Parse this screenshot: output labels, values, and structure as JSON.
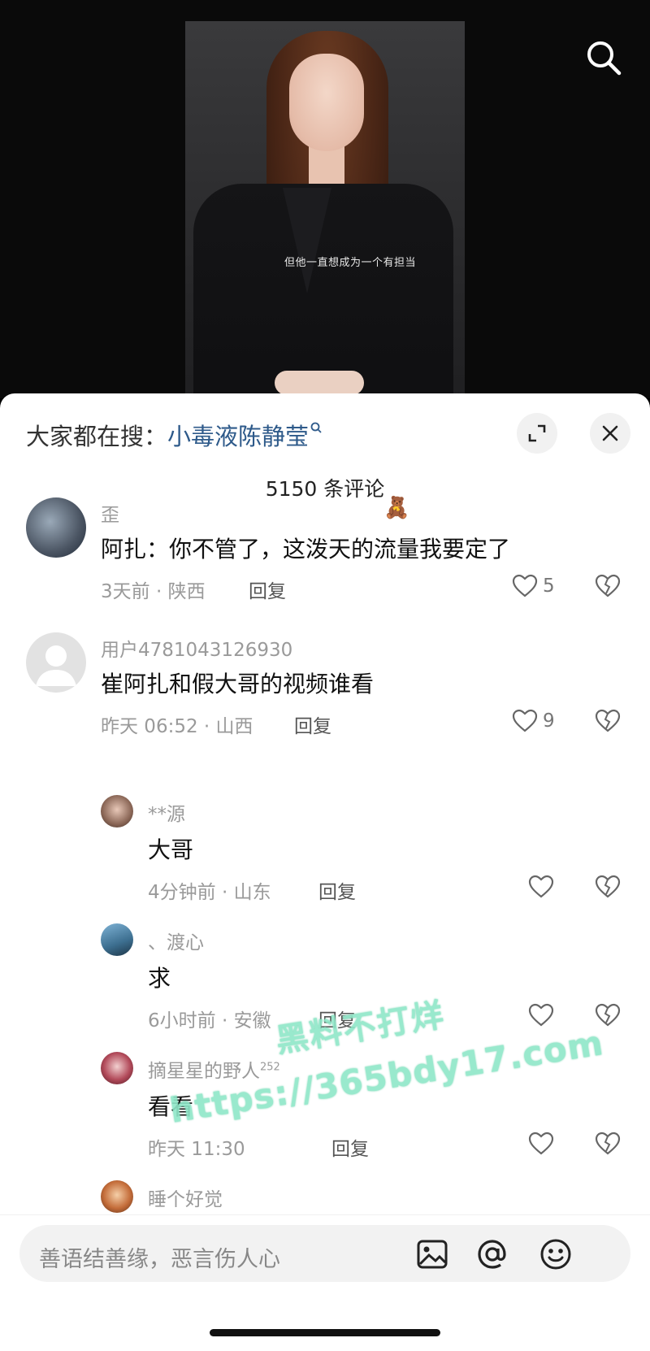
{
  "video": {
    "subtitle": "但他一直想成为一个有担当"
  },
  "header": {
    "hot_search_prefix": "大家都在搜：",
    "hot_search_keyword": "小毒液陈静莹",
    "comment_count": "5150 条评论"
  },
  "comments": [
    {
      "username": "歪",
      "text": "阿扎：你不管了，这泼天的流量我要定了",
      "meta": "3天前 · 陕西",
      "reply": "回复",
      "likes": "5"
    },
    {
      "username": "用户4781043126930",
      "text": "崔阿扎和假大哥的视频谁看",
      "meta": "昨天 06:52 · 山西",
      "reply": "回复",
      "likes": "9",
      "replies": [
        {
          "username": "**源",
          "text": "大哥",
          "meta": "4分钟前 · 山东",
          "reply": "回复"
        },
        {
          "username": "、渡心",
          "text": "求",
          "meta": "6小时前 · 安徽",
          "reply": "回复"
        },
        {
          "username": "摘星星的野人",
          "badge": "252",
          "text": "看看",
          "meta": "昨天 11:30",
          "reply": "回复"
        },
        {
          "username": "睡个好觉"
        }
      ]
    }
  ],
  "watermark": {
    "line1": "黑料不打烊",
    "line2": "https://365bdy17.com"
  },
  "input": {
    "placeholder": "善语结善缘，恶言伤人心"
  },
  "icons": {
    "search": "search-icon",
    "expand": "expand-icon",
    "close": "close-icon",
    "like": "heart-icon",
    "dislike": "broken-heart-icon",
    "image": "image-icon",
    "mention": "at-icon",
    "emoji": "emoji-icon"
  }
}
